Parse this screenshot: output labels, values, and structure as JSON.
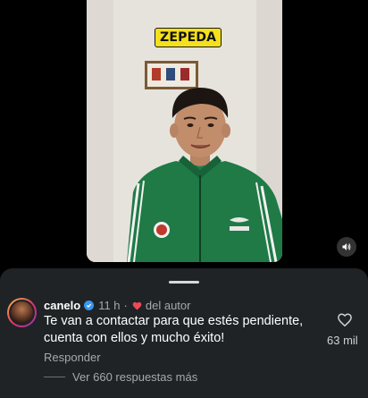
{
  "video": {
    "caption": "ZEPEDA",
    "mute_icon": "speaker-volume-icon"
  },
  "comment": {
    "username": "canelo",
    "verified_icon": "verified-badge-icon",
    "time": "11 h",
    "separator": "·",
    "author_heart_icon": "heart-filled-icon",
    "author_label": "del autor",
    "text": "Te van a contactar  para que estés pendiente, cuenta con ellos y mucho éxito!",
    "reply_label": "Responder",
    "like_icon": "heart-outline-icon",
    "like_count": "63 mil",
    "view_replies_label": "Ver 660 respuestas más"
  },
  "colors": {
    "sheet_bg": "#1f2326",
    "verified": "#3897f0",
    "author_heart": "#ed4956",
    "caption_bg": "#f4e01c",
    "jacket_green": "#1f7a45"
  }
}
